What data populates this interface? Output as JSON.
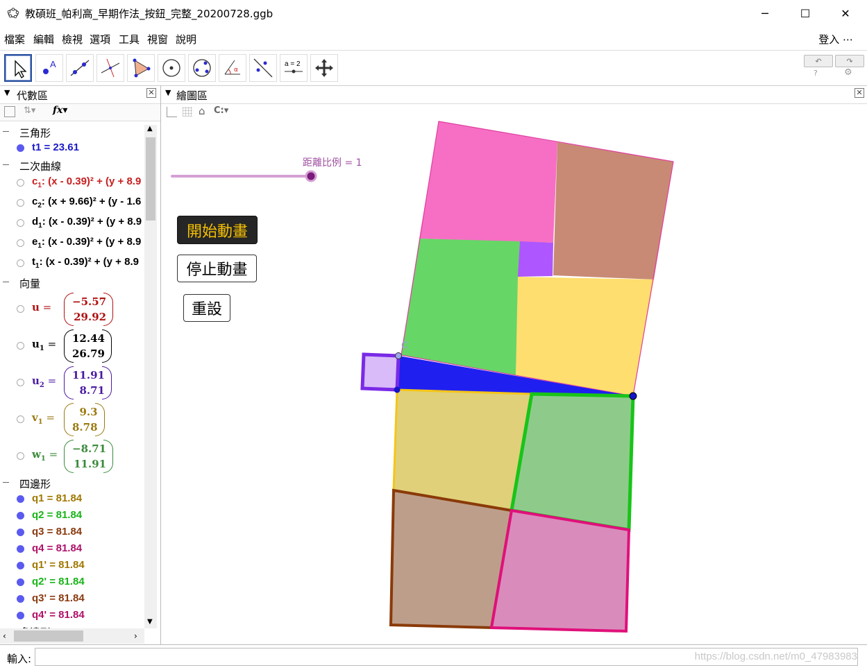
{
  "window": {
    "title": "教碩班_帕利高_早期作法_按鈕_完整_20200728.ggb",
    "controls": {
      "minimize": "─",
      "maximize": "☐",
      "close": "✕"
    }
  },
  "menu": {
    "items": [
      "檔案",
      "編輯",
      "檢視",
      "選項",
      "工具",
      "視窗",
      "說明"
    ],
    "login": "登入",
    "more": "⋯"
  },
  "toolbar": {
    "tools": [
      "move-tool-icon",
      "point-tool-icon",
      "line-tool-icon",
      "perpendicular-tool-icon",
      "polygon-tool-icon",
      "circle-tool-icon",
      "conic-tool-icon",
      "angle-tool-icon",
      "reflect-tool-icon",
      "slider-tool-icon",
      "move-graphics-tool-icon"
    ],
    "slider_tool_text": "a = 2"
  },
  "algebra": {
    "panel_title": "代數區",
    "fx": "fx",
    "groups": [
      {
        "label": "三角形",
        "rows": [
          {
            "text": "t1 = 23.61",
            "color": "#1a1ac8",
            "visible": true
          }
        ]
      },
      {
        "label": "二次曲線",
        "rows": [
          {
            "name": "c",
            "sub": "1",
            "rest": ": (x - 0.39)² + (y + 8.9",
            "color": "#c81e1e",
            "visible": false
          },
          {
            "name": "c",
            "sub": "2",
            "rest": ": (x + 9.66)² + (y - 1.6",
            "color": "#000000",
            "visible": false
          },
          {
            "name": "d",
            "sub": "1",
            "rest": ": (x - 0.39)² + (y + 8.9",
            "color": "#000000",
            "visible": false
          },
          {
            "name": "e",
            "sub": "1",
            "rest": ": (x - 0.39)² + (y + 8.9",
            "color": "#000000",
            "visible": false
          },
          {
            "name": "t",
            "sub": "1",
            "rest": ": (x - 0.39)² + (y + 8.9",
            "color": "#000000",
            "visible": false
          }
        ]
      },
      {
        "label": "向量",
        "vectors": [
          {
            "name": "u",
            "sub": "",
            "a": "−5.57",
            "b": "29.92",
            "color": "#b01010"
          },
          {
            "name": "u",
            "sub": "1",
            "a": "12.44",
            "b": "26.79",
            "color": "#000000"
          },
          {
            "name": "u",
            "sub": "2",
            "a": "11.91",
            "b": "8.71",
            "color": "#4a1aa0"
          },
          {
            "name": "v",
            "sub": "1",
            "a": "9.3",
            "b": "8.78",
            "color": "#9a7a10"
          },
          {
            "name": "w",
            "sub": "1",
            "a": "−8.71",
            "b": "11.91",
            "color": "#3a8a3a"
          }
        ]
      },
      {
        "label": "四邊形",
        "rows": [
          {
            "text": "q1 = 81.84",
            "color": "#a07800"
          },
          {
            "text": "q2 = 81.84",
            "color": "#18b418"
          },
          {
            "text": "q3 = 81.84",
            "color": "#8a3a10"
          },
          {
            "text": "q4 = 81.84",
            "color": "#b0106a"
          },
          {
            "text": "q1' = 81.84",
            "color": "#a07800"
          },
          {
            "text": "q2' = 81.84",
            "color": "#18b418"
          },
          {
            "text": "q3' = 81.84",
            "color": "#8a3a10"
          },
          {
            "text": "q4' = 81.84",
            "color": "#b0106a"
          }
        ]
      },
      {
        "label": "多邊形"
      }
    ]
  },
  "graphics": {
    "panel_title": "繪圖區",
    "slider_label": "距離比例 = 1",
    "point_label": "C",
    "buttons": {
      "start": "開始動畫",
      "stop": "停止動畫",
      "reset": "重設"
    }
  },
  "input": {
    "label": "輸入:",
    "value": "",
    "watermark": "https://blog.csdn.net/m0_47983983"
  }
}
